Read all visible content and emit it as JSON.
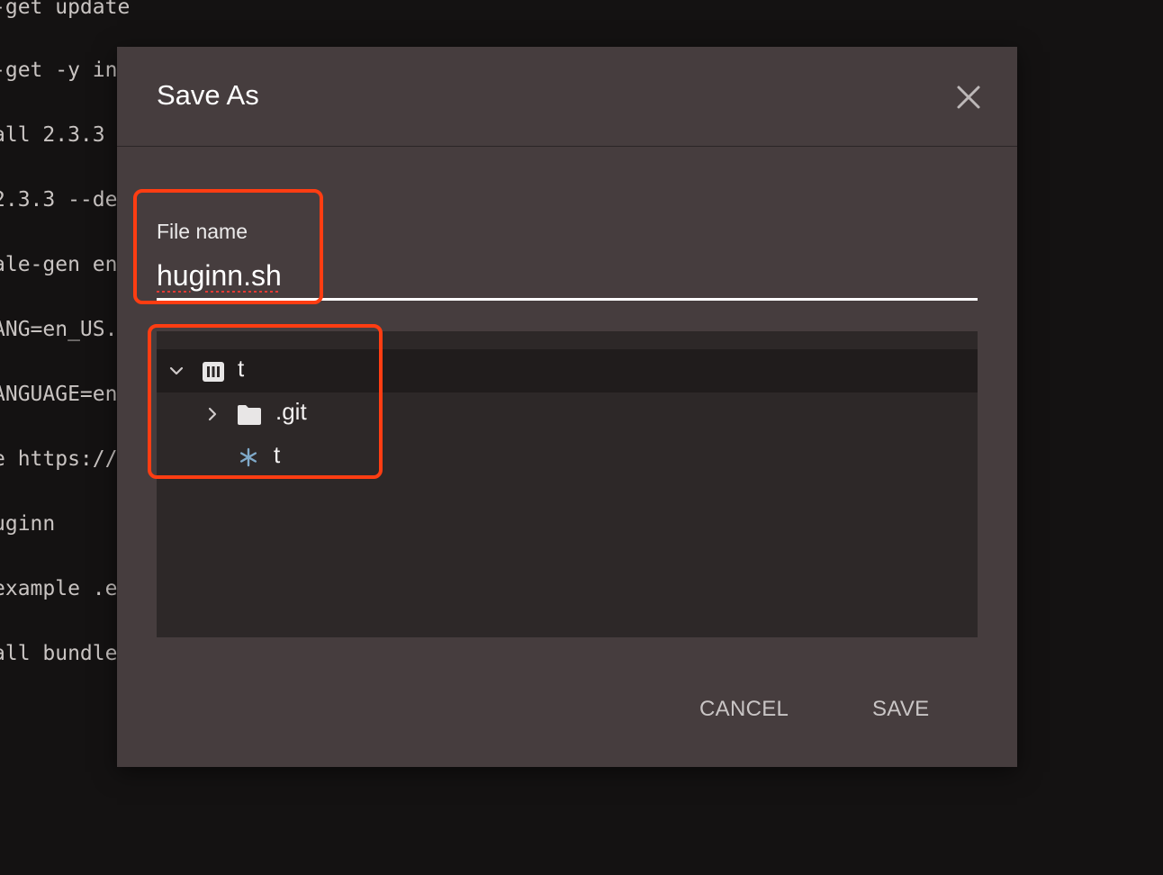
{
  "terminal": {
    "lines": [
      "-get update",
      "-get -y in",
      "all 2.3.3",
      "2.3.3 --de",
      "ale-gen en",
      "ANG=en_US.",
      "ANGUAGE=en",
      "e https://",
      "uginn",
      "example .e",
      "all bundle"
    ]
  },
  "dialog": {
    "title": "Save As",
    "close_icon": "close-icon",
    "file_name_label": "File name",
    "file_name_value": "huginn.sh",
    "tree": [
      {
        "label": "t",
        "icon": "repo-icon",
        "expanded": true,
        "selected": true
      },
      {
        "label": ".git",
        "icon": "folder-icon",
        "expanded": false,
        "selected": false
      },
      {
        "label": "t",
        "icon": "asterisk-file-icon",
        "selected": false
      }
    ],
    "cancel_label": "CANCEL",
    "save_label": "SAVE"
  },
  "colors": {
    "dialog_bg": "#463d3e",
    "tree_bg": "#2d2828",
    "highlight": "#ff3d12",
    "asterisk": "#7fa9c9"
  }
}
